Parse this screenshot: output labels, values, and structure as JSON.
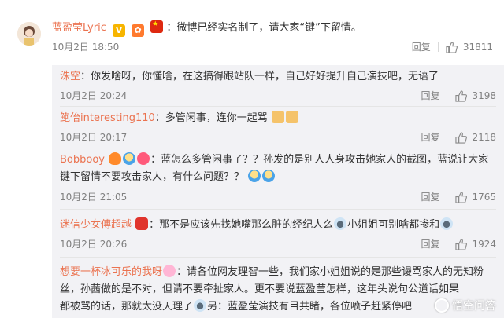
{
  "main_comment": {
    "username": "蓝盈莹Lyric",
    "badges": [
      "V",
      "✿",
      "★"
    ],
    "text": "：微博已经实名制了，请大家“键”下留情。",
    "time": "10月2日 18:50",
    "reply_label": "回复",
    "like_count": "31811"
  },
  "replies": [
    {
      "username": "洙空",
      "text": "：你发啥呀，你懂啥，在这搞得跟站队一样，自己好好提升自己演技吧，无语了",
      "time": "10月2日 20:24",
      "reply_label": "回复",
      "like_count": "3198"
    },
    {
      "username": "鲍佁interesting110",
      "text": "：多管闲事，连你一起骂",
      "time": "10月2日 20:17",
      "reply_label": "回复",
      "like_count": "2118"
    },
    {
      "username": "Bobbooy",
      "text_line1": "：蓝怎么多管闲事了？？孙发的是别人人身攻击她家人的截图，蓝说让大家",
      "text_line2": "键下留情不要攻击家人，有什么问题？？",
      "time": "10月2日 21:05",
      "reply_label": "回复",
      "like_count": "1765"
    },
    {
      "username": "迷信少女傅超越",
      "text_a": "：那不是应该先找她嘴那么脏的经纪人么",
      "text_b": "小姐姐可别啥都掺和",
      "time": "10月2日 20:26",
      "reply_label": "回复",
      "like_count": "1924"
    },
    {
      "username": "想要一杯冰可乐的我呀",
      "text_line1": "：请各位网友理智一些，我们家小姐姐说的是那些谩骂家人的无知粉",
      "text_line2": "丝，孙茜做的是不对，但请不要牵扯家人。更不要说蓝盈莹怎样，这年头说句公道话如果",
      "text_line3_a": "都被骂的话，那就太没天理了",
      "text_line3_b": "另：蓝盈莹演技有目共睹，各位喷子赶紧停吧"
    }
  ],
  "watermark": "悟空问答",
  "colors": {
    "username": "#eb7350",
    "text": "#333333",
    "meta": "#808080",
    "reply_bg": "#f2f2f5"
  },
  "icons": [
    "thumbs-up-icon",
    "emoji-icon",
    "verified-badge-icon",
    "china-flag-icon"
  ]
}
